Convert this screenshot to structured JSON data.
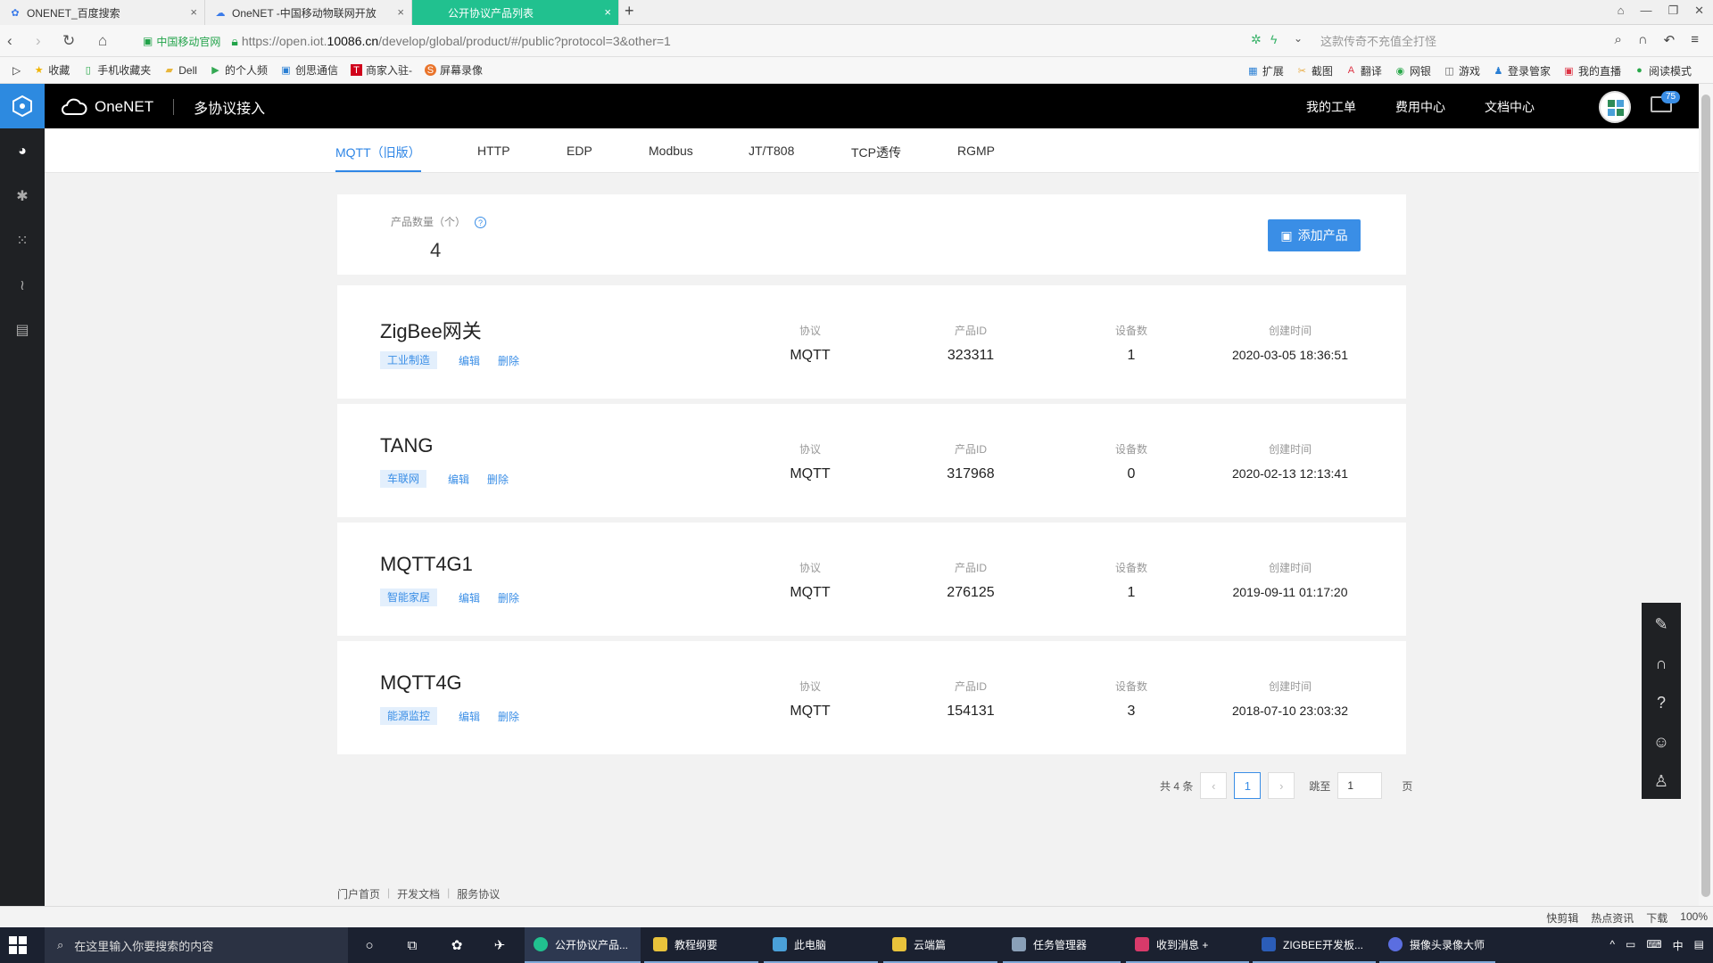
{
  "browser": {
    "tabs": [
      {
        "label": "ONENET_百度搜索"
      },
      {
        "label": "OneNET -中国移动物联网开放"
      },
      {
        "label": "公开协议产品列表"
      }
    ],
    "new_tab": "+",
    "cert_label": "中国移动官网",
    "url_prefix": "https://open.iot.",
    "url_domain": "10086.cn",
    "url_suffix": "/develop/global/product/#/public?protocol=3&other=1",
    "search_placeholder": "这款传奇不充值全打怪",
    "bookmarks": [
      "收藏",
      "手机收藏夹",
      "Dell",
      "的个人频",
      "创思通信",
      "商家入驻-",
      "屏幕录像"
    ],
    "bookmarks_right": [
      "扩展",
      "截图",
      "翻译",
      "网银",
      "游戏",
      "登录管家",
      "我的直播",
      "阅读模式"
    ]
  },
  "app": {
    "brand": "OneNET",
    "subtitle": "多协议接入",
    "header_links": [
      "我的工单",
      "费用中心",
      "文档中心"
    ],
    "mail_count": "75",
    "protocol_tabs": [
      "MQTT（旧版）",
      "HTTP",
      "EDP",
      "Modbus",
      "JT/T808",
      "TCP透传",
      "RGMP"
    ],
    "summary": {
      "label": "产品数量（个）",
      "count": "4",
      "add_button": "添加产品"
    },
    "column_headers": {
      "protocol": "协议",
      "product_id": "产品ID",
      "device_count": "设备数",
      "created": "创建时间"
    },
    "actions": {
      "edit": "编辑",
      "delete": "删除"
    },
    "products": [
      {
        "name": "ZigBee网关",
        "tag": "工业制造",
        "protocol": "MQTT",
        "product_id": "323311",
        "devices": "1",
        "created": "2020-03-05 18:36:51"
      },
      {
        "name": "TANG",
        "tag": "车联网",
        "protocol": "MQTT",
        "product_id": "317968",
        "devices": "0",
        "created": "2020-02-13 12:13:41"
      },
      {
        "name": "MQTT4G1",
        "tag": "智能家居",
        "protocol": "MQTT",
        "product_id": "276125",
        "devices": "1",
        "created": "2019-09-11 01:17:20"
      },
      {
        "name": "MQTT4G",
        "tag": "能源监控",
        "protocol": "MQTT",
        "product_id": "154131",
        "devices": "3",
        "created": "2018-07-10 23:03:32"
      }
    ],
    "pagination": {
      "total": "共 4 条",
      "prev": "‹",
      "current": "1",
      "next": "›",
      "jump_label": "跳至",
      "jump_value": "1",
      "page_unit": "页"
    },
    "footer_links": [
      "门户首页",
      "开发文档",
      "服务协议"
    ]
  },
  "statusbar": {
    "items": [
      "快剪辑",
      "热点资讯",
      "下载",
      "100%"
    ]
  },
  "taskbar": {
    "search_placeholder": "在这里输入你要搜索的内容",
    "items": [
      "公开协议产品...",
      "教程纲要",
      "此电脑",
      "云端篇",
      "任务管理器",
      "收到消息 +",
      "ZIGBEE开发板...",
      "摄像头录像大师"
    ],
    "tray_text": "中"
  },
  "colors": {
    "accent": "#3a8ee6",
    "active_tab": "#21c18f",
    "header_bg": "#000000",
    "sidebar_bg": "#1f2124"
  }
}
